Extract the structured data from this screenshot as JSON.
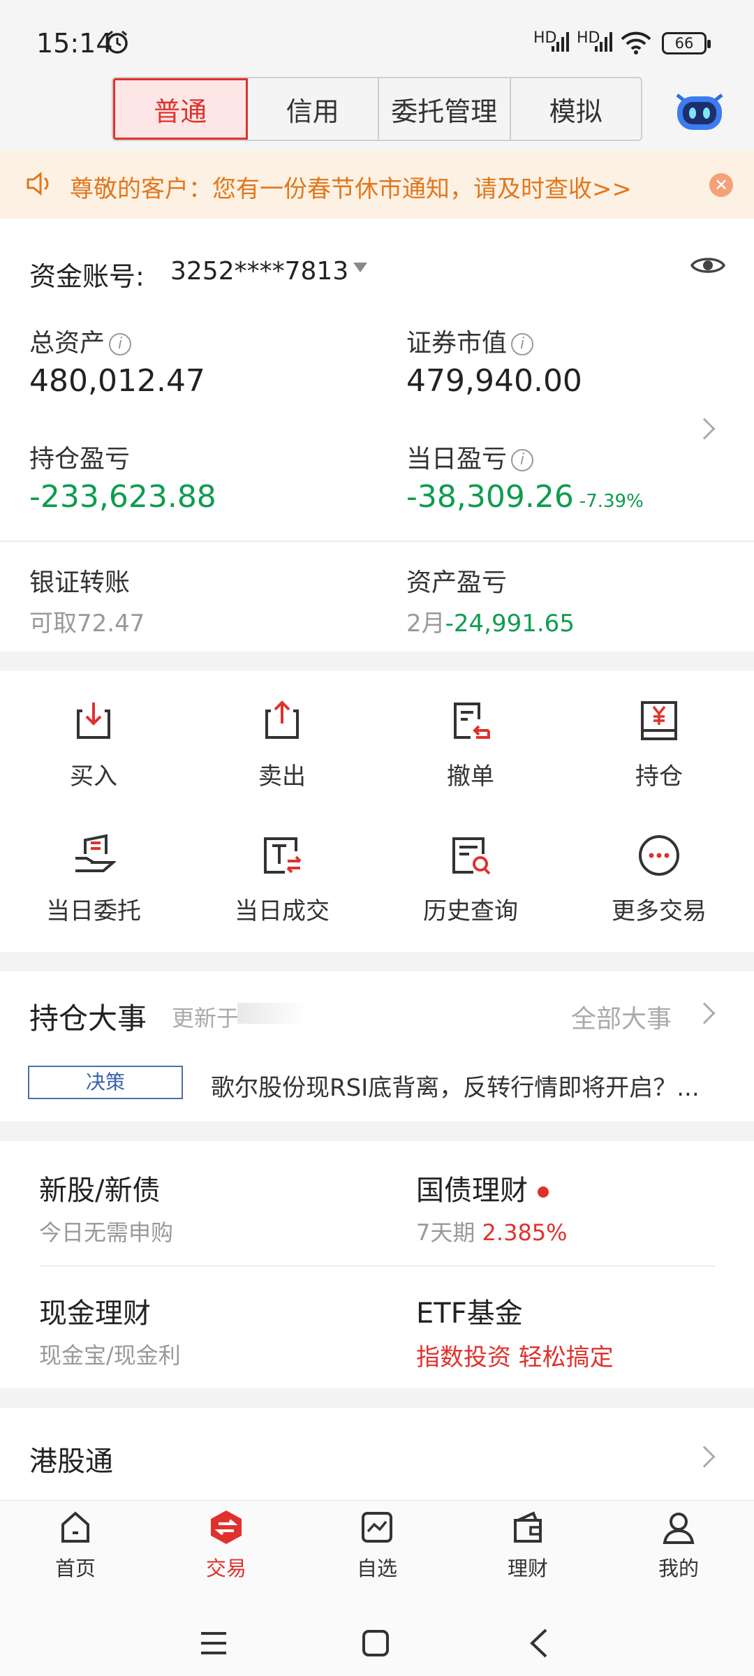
{
  "status": {
    "time": "15:14",
    "signal1": "HD",
    "signal2": "HD",
    "battery": "66"
  },
  "tabs": [
    "普通",
    "信用",
    "委托管理",
    "模拟"
  ],
  "notice": {
    "text": "尊敬的客户：您有一份春节休市通知，请及时查收>>"
  },
  "account": {
    "label": "资金账号:",
    "number": "3252****7813"
  },
  "assets": {
    "total_label": "总资产",
    "total_value": "480,012.47",
    "market_label": "证券市值",
    "market_value": "479,940.00",
    "position_pl_label": "持仓盈亏",
    "position_pl_value": "-233,623.88",
    "day_pl_label": "当日盈亏",
    "day_pl_value": "-38,309.26",
    "day_pl_pct": "-7.39%"
  },
  "transfer": {
    "label": "银证转账",
    "sub": "可取72.47"
  },
  "asset_pl": {
    "label": "资产盈亏",
    "month": "2月",
    "value": "-24,991.65"
  },
  "actions": [
    {
      "label": "买入",
      "icon": "buy-icon"
    },
    {
      "label": "卖出",
      "icon": "sell-icon"
    },
    {
      "label": "撤单",
      "icon": "cancel-order-icon"
    },
    {
      "label": "持仓",
      "icon": "position-icon"
    },
    {
      "label": "当日委托",
      "icon": "today-order-icon"
    },
    {
      "label": "当日成交",
      "icon": "today-deal-icon"
    },
    {
      "label": "历史查询",
      "icon": "history-query-icon"
    },
    {
      "label": "更多交易",
      "icon": "more-trade-icon"
    }
  ],
  "events": {
    "title": "持仓大事",
    "updated": "更新于",
    "all": "全部大事",
    "tag": "决策",
    "headline": "歌尔股份现RSI底背离，反转行情即将开启？..."
  },
  "products": {
    "ipo_title": "新股/新债",
    "ipo_sub": "今日无需申购",
    "bond_title": "国债理财",
    "bond_sub_prefix": "7天期",
    "bond_rate": "2.385%",
    "cash_title": "现金理财",
    "cash_sub": "现金宝/现金利",
    "etf_title": "ETF基金",
    "etf_sub": "指数投资 轻松搞定"
  },
  "hk": {
    "title": "港股通"
  },
  "nav": [
    "首页",
    "交易",
    "自选",
    "理财",
    "我的"
  ]
}
